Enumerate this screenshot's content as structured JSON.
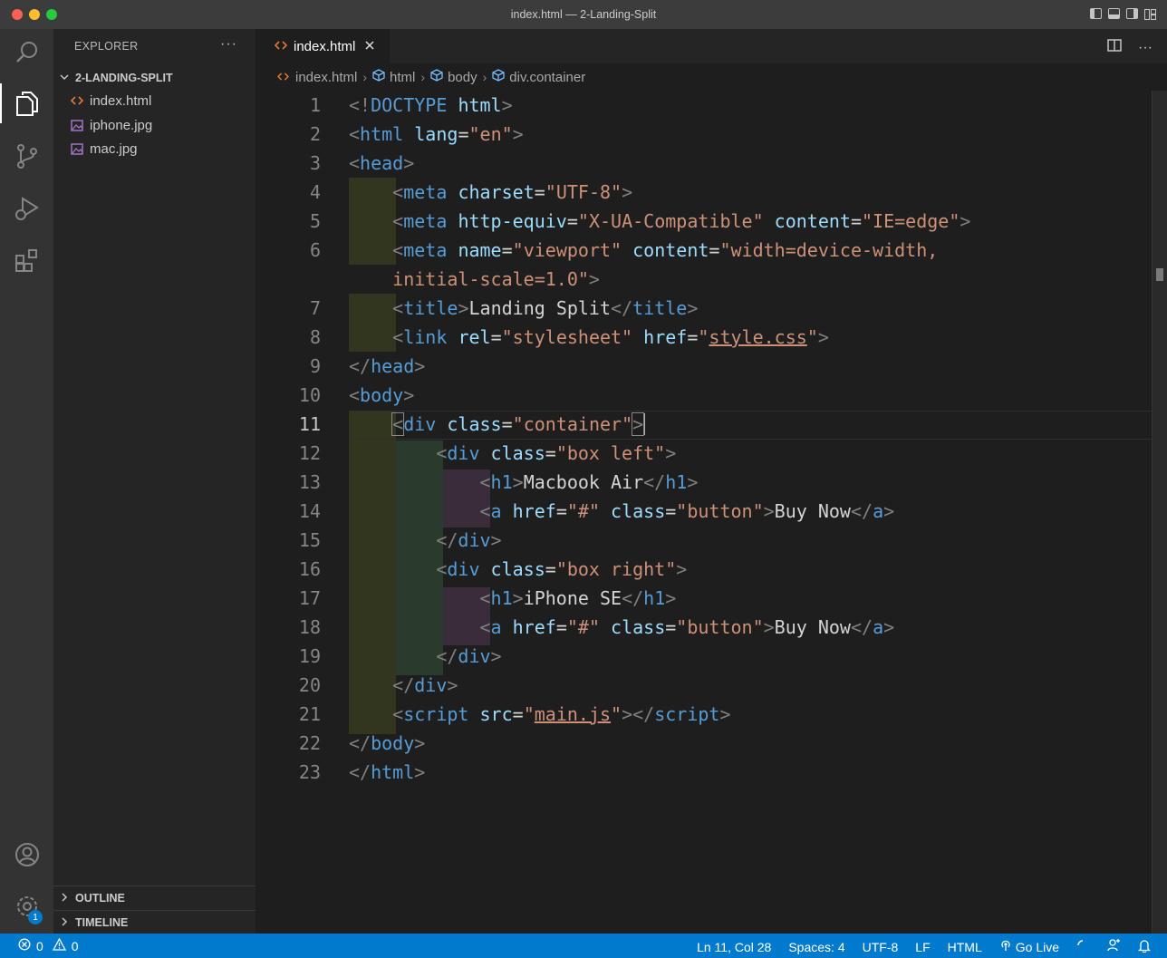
{
  "window": {
    "title": "index.html — 2-Landing-Split"
  },
  "sidebar": {
    "header": "EXPLORER",
    "more": "···",
    "folder": "2-LANDING-SPLIT",
    "files": [
      {
        "name": "index.html",
        "icon": "html-file-icon"
      },
      {
        "name": "iphone.jpg",
        "icon": "image-file-icon"
      },
      {
        "name": "mac.jpg",
        "icon": "image-file-icon"
      }
    ],
    "outline": "OUTLINE",
    "timeline": "TIMELINE"
  },
  "activity": {
    "settings_badge": "1"
  },
  "tab": {
    "label": "index.html"
  },
  "breadcrumb": [
    "index.html",
    "html",
    "body",
    "div.container"
  ],
  "editor": {
    "line_numbers": [
      "1",
      "2",
      "3",
      "4",
      "5",
      "6",
      "7",
      "8",
      "9",
      "10",
      "11",
      "12",
      "13",
      "14",
      "15",
      "16",
      "17",
      "18",
      "19",
      "20",
      "21",
      "22",
      "23"
    ],
    "current_line": 11
  },
  "statusbar": {
    "errors": "0",
    "warnings": "0",
    "position": "Ln 11, Col 28",
    "spaces": "Spaces: 4",
    "encoding": "UTF-8",
    "eol": "LF",
    "language": "HTML",
    "golive": "Go Live"
  },
  "colors": {
    "accent": "#007acc",
    "tag": "#569cd6",
    "attribute": "#9cdcfe",
    "string": "#ce9178",
    "punctuation": "#808080"
  }
}
